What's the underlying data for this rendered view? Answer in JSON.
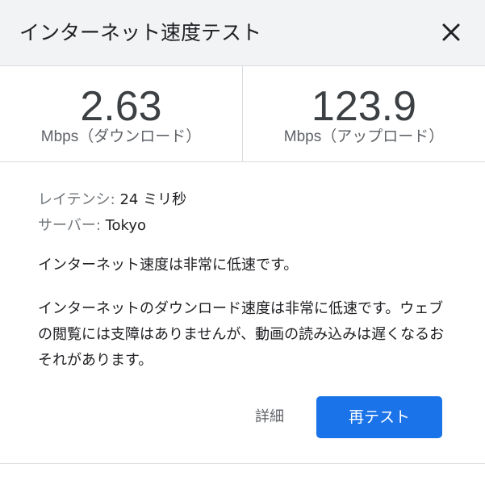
{
  "header": {
    "title": "インターネット速度テスト",
    "close_icon": "close-icon"
  },
  "metrics": {
    "download": {
      "value": "2.63",
      "unit": "Mbps",
      "label": "（ダウンロード）"
    },
    "upload": {
      "value": "123.9",
      "unit": "Mbps",
      "label": "（アップロード）"
    }
  },
  "details": {
    "latency_label": "レイテンシ: ",
    "latency_value": "24 ミリ秒",
    "server_label": "サーバー: ",
    "server_value": "Tokyo"
  },
  "messages": {
    "summary": "インターネット速度は非常に低速です。",
    "description": "インターネットのダウンロード速度は非常に低速です。ウェブの閲覧には支障はありませんが、動画の読み込みは遅くなるおそれがあります。"
  },
  "actions": {
    "details_label": "詳細",
    "retest_label": "再テスト"
  },
  "colors": {
    "header_bg": "#f1f3f4",
    "accent": "#1a73e8",
    "divider": "#dadce0"
  }
}
